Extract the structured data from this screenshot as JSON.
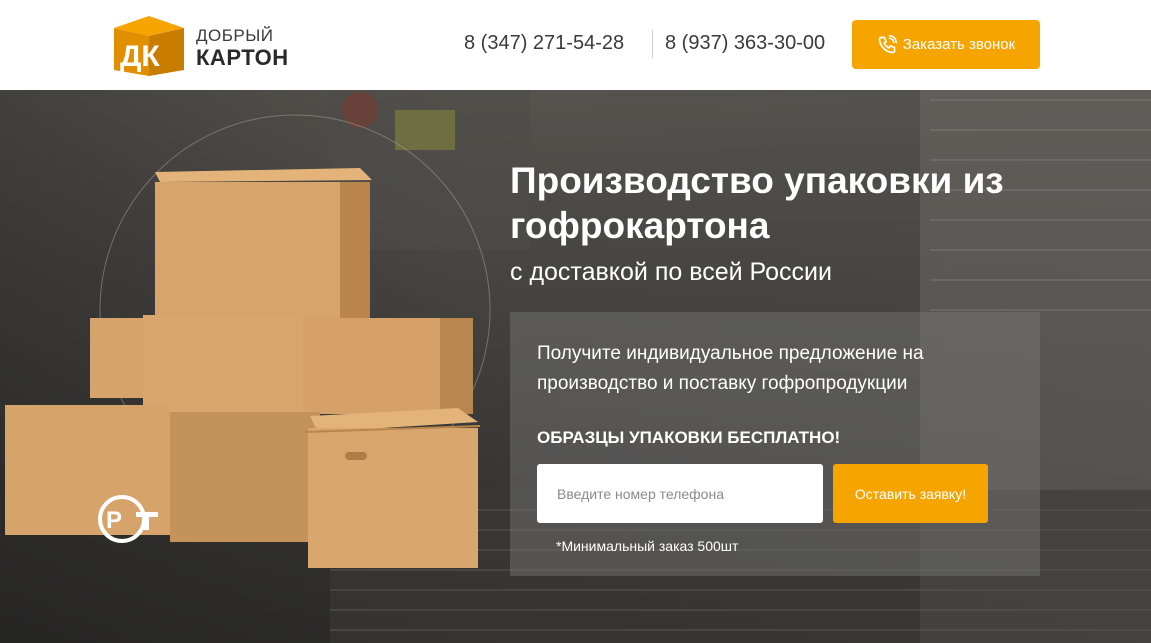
{
  "header": {
    "logo": {
      "letters": "ДК",
      "line1": "ДОБРЫЙ",
      "line2": "КАРТОН"
    },
    "phones": [
      "8 (347) 271-54-28",
      "8 (937) 363-30-00"
    ],
    "call_button": {
      "label": "Заказать звонок",
      "icon": "phone-icon"
    }
  },
  "hero": {
    "title": "Производство упаковки из гофрокартона",
    "subtitle": "с доставкой по всей России",
    "offer": {
      "text": "Получите индивидуальное предложение на производство и поставку гофропродукции",
      "highlight": "ОБРАЗЦЫ УПАКОВКИ БЕСПЛАТНО!",
      "input_placeholder": "Введите номер телефона",
      "submit_label": "Оставить заявку!",
      "note": "*Минимальный заказ 500шт"
    },
    "badge": "РСТ"
  },
  "colors": {
    "accent": "#f6a500",
    "header_bg": "#ffffff",
    "text_dark": "#3a3a3a",
    "box_light": "#d9a56c",
    "box_dark": "#b8834b"
  }
}
